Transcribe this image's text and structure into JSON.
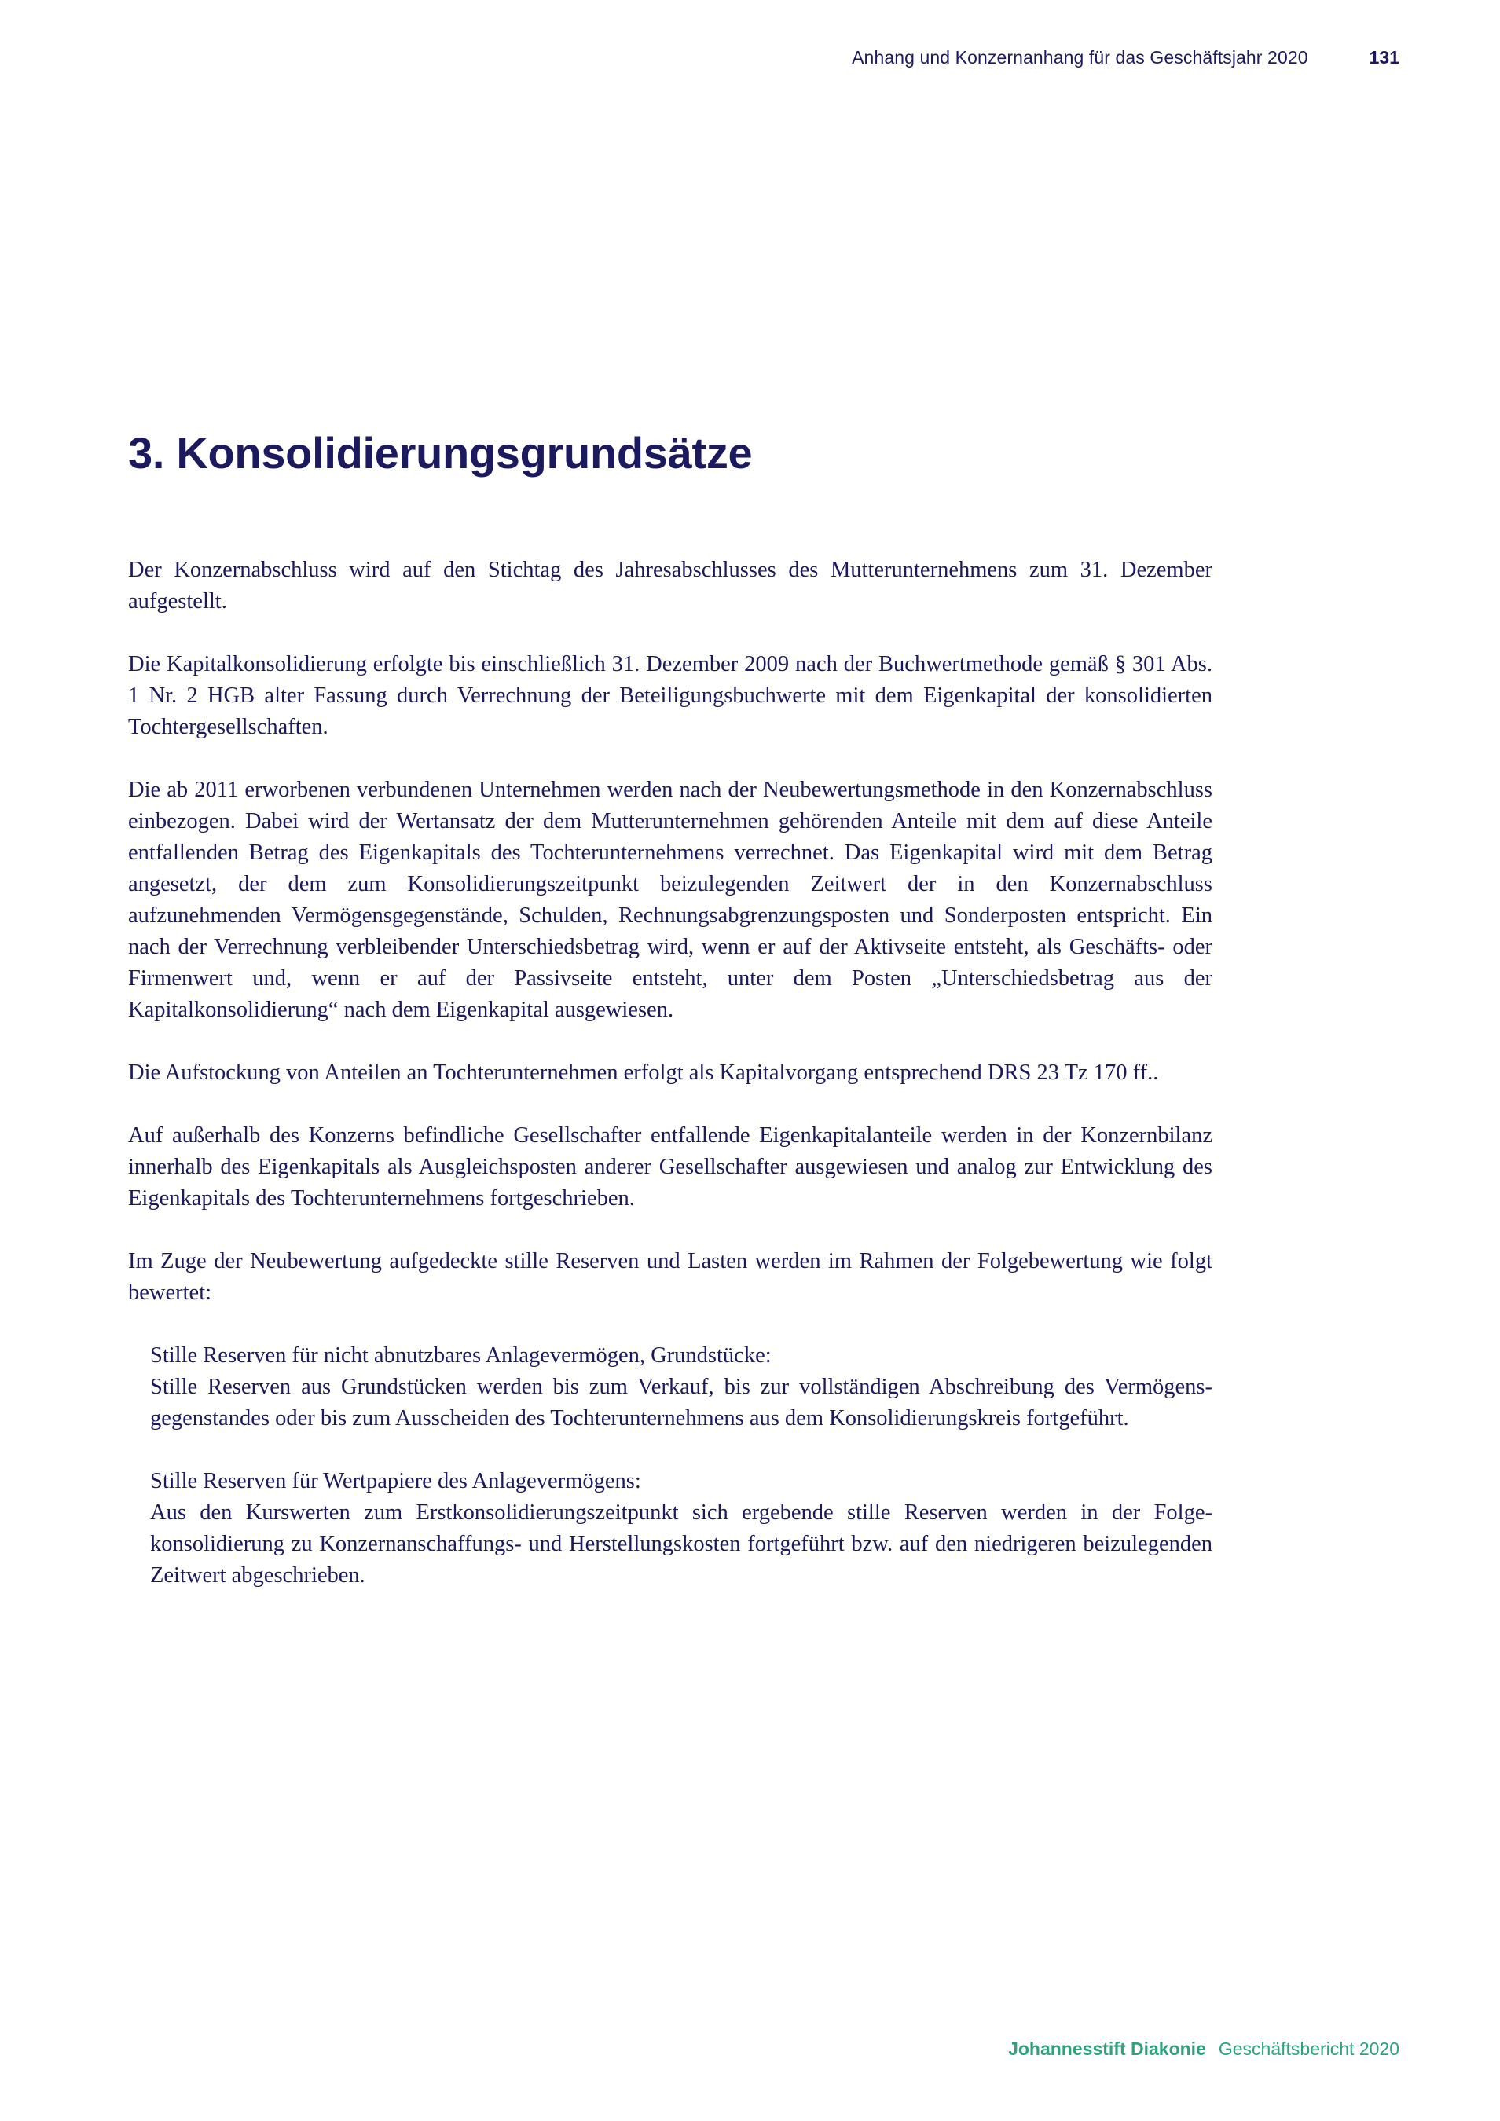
{
  "header": {
    "title": "Anhang und Konzernanhang für das Geschäftsjahr 2020",
    "page_number": "131"
  },
  "section": {
    "heading": "3. Konsolidierungsgrundsätze"
  },
  "paragraphs": [
    "Der Konzernabschluss wird auf den Stichtag des Jahresabschlusses des Mutterunternehmens zum 31. Dezember aufgestellt.",
    "Die Kapitalkonsolidierung erfolgte bis einschließlich 31. Dezember 2009 nach der Buchwertmethode gemäß § 301 Abs. 1 Nr. 2 HGB alter Fassung durch Verrechnung der Beteiligungsbuchwerte mit dem Eigenkapital der konsolidierten Tochtergesellschaften.",
    "Die ab 2011 erworbenen verbundenen Unternehmen werden nach der Neubewertungsmethode in den Konzern­abschluss einbezogen. Dabei wird der Wertansatz der dem Mutterunternehmen gehörenden Anteile mit dem auf diese Anteile entfallenden Betrag des Eigenkapitals des Tochterunternehmens verrechnet. Das Eigenkapi­tal wird mit dem Betrag angesetzt, der dem zum Konsolidierungszeitpunkt beizulegenden Zeitwert der in den Konzernabschluss aufzunehmenden Vermögensgegenstände, Schulden, Rechnungsabgrenzungsposten und Sonderposten entspricht. Ein nach der Verrechnung verbleibender Unterschiedsbetrag wird, wenn er auf der Aktivseite entsteht, als Geschäfts- oder Firmenwert und, wenn er auf der Passivseite entsteht, unter dem Posten „Unterschiedsbetrag aus der Kapitalkonsolidierung“ nach dem Eigenkapital ausgewiesen.",
    "Die Aufstockung von Anteilen an Tochterunternehmen erfolgt als Kapitalvorgang entsprechend DRS 23 Tz 170 ff..",
    "Auf außerhalb des Konzerns befindliche Gesellschafter entfallende Eigenkapitalanteile werden in der Konzern­bilanz innerhalb des Eigenkapitals als Ausgleichsposten anderer Gesellschafter ausgewiesen und analog zur Entwicklung des Eigenkapitals des Tochterunternehmens fortgeschrieben.",
    "Im Zuge der Neubewertung aufgedeckte stille Reserven und Lasten werden im Rahmen der Folgebewertung wie folgt bewertet:"
  ],
  "sub_blocks": [
    {
      "heading": "Stille Reserven für nicht abnutzbares Anlagevermögen, Grundstücke:",
      "text": "Stille Reserven aus Grundstücken werden bis zum Verkauf, bis zur vollständigen Abschreibung des Vermögens­gegenstandes oder bis zum Ausscheiden des Tochterunternehmens aus dem Konsolidierungskreis fortgeführt."
    },
    {
      "heading": "Stille Reserven für Wertpapiere des Anlagevermögens:",
      "text": "Aus den Kurswerten zum Erstkonsolidierungszeitpunkt sich ergebende stille Reserven werden in der Folge­konsolidierung zu Konzernanschaffungs- und Herstellungskosten fortgeführt bzw. auf den niedrigeren beizu­legenden Zeitwert abgeschrieben."
    }
  ],
  "footer": {
    "organization": "Johannesstift Diakonie",
    "report": "Geschäftsbericht 2020"
  },
  "colors": {
    "text": "#1c1a5e",
    "footer_accent": "#2ca37a",
    "background": "#ffffff"
  }
}
